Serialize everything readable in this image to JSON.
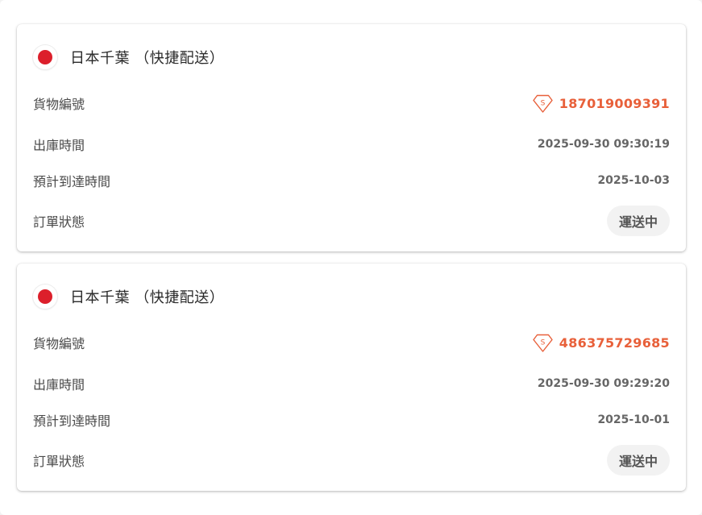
{
  "colors": {
    "accent": "#e8603a",
    "flag_red": "#dc1f2b",
    "pill_bg": "#f2f2f2"
  },
  "shipments": [
    {
      "destination": "日本千葉 （快捷配送）",
      "flag_icon": "japan-flag-icon",
      "tracking_label": "貨物編號",
      "tracking_icon": "tracking-badge-icon",
      "tracking_number": "187019009391",
      "outbound_label": "出庫時間",
      "outbound_time": "2025-09-30 09:30:19",
      "eta_label": "預計到達時間",
      "eta": "2025-10-03",
      "status_label": "訂單狀態",
      "status": "運送中"
    },
    {
      "destination": "日本千葉 （快捷配送）",
      "flag_icon": "japan-flag-icon",
      "tracking_label": "貨物編號",
      "tracking_icon": "tracking-badge-icon",
      "tracking_number": "486375729685",
      "outbound_label": "出庫時間",
      "outbound_time": "2025-09-30 09:29:20",
      "eta_label": "預計到達時間",
      "eta": "2025-10-01",
      "status_label": "訂單狀態",
      "status": "運送中"
    }
  ]
}
